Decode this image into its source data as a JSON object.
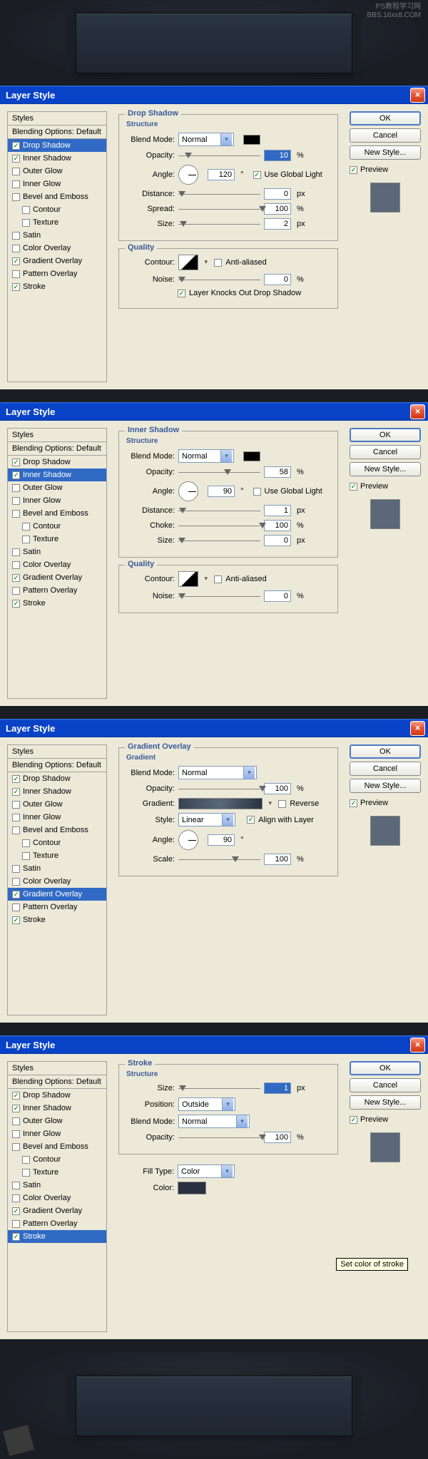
{
  "watermark": {
    "line1": "PS教程学习网",
    "line2": "BBS.16xx8.COM"
  },
  "dialogs": [
    {
      "title": "Layer Style",
      "styles_header": "Styles",
      "blending_title": "Blending Options: Default",
      "selected_style": "Drop Shadow",
      "style_items": [
        {
          "label": "Drop Shadow",
          "checked": true,
          "selected": true
        },
        {
          "label": "Inner Shadow",
          "checked": true
        },
        {
          "label": "Outer Glow",
          "checked": false
        },
        {
          "label": "Inner Glow",
          "checked": false
        },
        {
          "label": "Bevel and Emboss",
          "checked": false
        },
        {
          "label": "Contour",
          "checked": false,
          "indent": true
        },
        {
          "label": "Texture",
          "checked": false,
          "indent": true
        },
        {
          "label": "Satin",
          "checked": false
        },
        {
          "label": "Color Overlay",
          "checked": false
        },
        {
          "label": "Gradient Overlay",
          "checked": true
        },
        {
          "label": "Pattern Overlay",
          "checked": false
        },
        {
          "label": "Stroke",
          "checked": true
        }
      ],
      "panel": {
        "section_title": "Drop Shadow",
        "structure_label": "Structure",
        "blend_mode_label": "Blend Mode:",
        "blend_mode_value": "Normal",
        "opacity_label": "Opacity:",
        "opacity_value": "10",
        "opacity_unit": "%",
        "angle_label": "Angle:",
        "angle_value": "120",
        "angle_unit": "°",
        "global_light_label": "Use Global Light",
        "global_light": true,
        "distance_label": "Distance:",
        "distance_value": "0",
        "distance_unit": "px",
        "spread_label": "Spread:",
        "spread_value": "100",
        "spread_unit": "%",
        "size_label": "Size:",
        "size_value": "2",
        "size_unit": "px",
        "quality_label": "Quality",
        "contour_label": "Contour:",
        "anti_aliased_label": "Anti-aliased",
        "anti_aliased": false,
        "noise_label": "Noise:",
        "noise_value": "0",
        "noise_unit": "%",
        "knockout_label": "Layer Knocks Out Drop Shadow",
        "knockout": true
      },
      "buttons": {
        "ok": "OK",
        "cancel": "Cancel",
        "new_style": "New Style...",
        "preview": "Preview"
      }
    },
    {
      "title": "Layer Style",
      "styles_header": "Styles",
      "blending_title": "Blending Options: Default",
      "selected_style": "Inner Shadow",
      "style_items": [
        {
          "label": "Drop Shadow",
          "checked": true
        },
        {
          "label": "Inner Shadow",
          "checked": true,
          "selected": true
        },
        {
          "label": "Outer Glow",
          "checked": false
        },
        {
          "label": "Inner Glow",
          "checked": false
        },
        {
          "label": "Bevel and Emboss",
          "checked": false
        },
        {
          "label": "Contour",
          "checked": false,
          "indent": true
        },
        {
          "label": "Texture",
          "checked": false,
          "indent": true
        },
        {
          "label": "Satin",
          "checked": false
        },
        {
          "label": "Color Overlay",
          "checked": false
        },
        {
          "label": "Gradient Overlay",
          "checked": true
        },
        {
          "label": "Pattern Overlay",
          "checked": false
        },
        {
          "label": "Stroke",
          "checked": true
        }
      ],
      "panel": {
        "section_title": "Inner Shadow",
        "structure_label": "Structure",
        "blend_mode_label": "Blend Mode:",
        "blend_mode_value": "Normal",
        "opacity_label": "Opacity:",
        "opacity_value": "58",
        "opacity_unit": "%",
        "angle_label": "Angle:",
        "angle_value": "90",
        "angle_unit": "°",
        "global_light_label": "Use Global Light",
        "global_light": false,
        "distance_label": "Distance:",
        "distance_value": "1",
        "distance_unit": "px",
        "choke_label": "Choke:",
        "choke_value": "100",
        "choke_unit": "%",
        "size_label": "Size:",
        "size_value": "0",
        "size_unit": "px",
        "quality_label": "Quality",
        "contour_label": "Contour:",
        "anti_aliased_label": "Anti-aliased",
        "anti_aliased": false,
        "noise_label": "Noise:",
        "noise_value": "0",
        "noise_unit": "%"
      },
      "buttons": {
        "ok": "OK",
        "cancel": "Cancel",
        "new_style": "New Style...",
        "preview": "Preview"
      }
    },
    {
      "title": "Layer Style",
      "styles_header": "Styles",
      "blending_title": "Blending Options: Default",
      "selected_style": "Gradient Overlay",
      "style_items": [
        {
          "label": "Drop Shadow",
          "checked": true
        },
        {
          "label": "Inner Shadow",
          "checked": true
        },
        {
          "label": "Outer Glow",
          "checked": false
        },
        {
          "label": "Inner Glow",
          "checked": false
        },
        {
          "label": "Bevel and Emboss",
          "checked": false
        },
        {
          "label": "Contour",
          "checked": false,
          "indent": true
        },
        {
          "label": "Texture",
          "checked": false,
          "indent": true
        },
        {
          "label": "Satin",
          "checked": false
        },
        {
          "label": "Color Overlay",
          "checked": false
        },
        {
          "label": "Gradient Overlay",
          "checked": true,
          "selected": true
        },
        {
          "label": "Pattern Overlay",
          "checked": false
        },
        {
          "label": "Stroke",
          "checked": true
        }
      ],
      "panel": {
        "section_title": "Gradient Overlay",
        "gradient_label": "Gradient",
        "blend_mode_label": "Blend Mode:",
        "blend_mode_value": "Normal",
        "opacity_label": "Opacity:",
        "opacity_value": "100",
        "opacity_unit": "%",
        "gradient_field_label": "Gradient:",
        "reverse_label": "Reverse",
        "reverse": false,
        "style_label": "Style:",
        "style_value": "Linear",
        "align_label": "Align with Layer",
        "align": true,
        "angle_label": "Angle:",
        "angle_value": "90",
        "angle_unit": "°",
        "scale_label": "Scale:",
        "scale_value": "100",
        "scale_unit": "%"
      },
      "buttons": {
        "ok": "OK",
        "cancel": "Cancel",
        "new_style": "New Style...",
        "preview": "Preview"
      }
    },
    {
      "title": "Layer Style",
      "styles_header": "Styles",
      "blending_title": "Blending Options: Default",
      "selected_style": "Stroke",
      "style_items": [
        {
          "label": "Drop Shadow",
          "checked": true
        },
        {
          "label": "Inner Shadow",
          "checked": true
        },
        {
          "label": "Outer Glow",
          "checked": false
        },
        {
          "label": "Inner Glow",
          "checked": false
        },
        {
          "label": "Bevel and Emboss",
          "checked": false
        },
        {
          "label": "Contour",
          "checked": false,
          "indent": true
        },
        {
          "label": "Texture",
          "checked": false,
          "indent": true
        },
        {
          "label": "Satin",
          "checked": false
        },
        {
          "label": "Color Overlay",
          "checked": false
        },
        {
          "label": "Gradient Overlay",
          "checked": true
        },
        {
          "label": "Pattern Overlay",
          "checked": false
        },
        {
          "label": "Stroke",
          "checked": true,
          "selected": true
        }
      ],
      "panel": {
        "section_title": "Stroke",
        "structure_label": "Structure",
        "size_label": "Size:",
        "size_value": "1",
        "size_unit": "px",
        "position_label": "Position:",
        "position_value": "Outside",
        "blend_mode_label": "Blend Mode:",
        "blend_mode_value": "Normal",
        "opacity_label": "Opacity:",
        "opacity_value": "100",
        "opacity_unit": "%",
        "fill_type_label": "Fill Type:",
        "fill_type_value": "Color",
        "color_label": "Color:",
        "tooltip": "Set color of stroke"
      },
      "buttons": {
        "ok": "OK",
        "cancel": "Cancel",
        "new_style": "New Style...",
        "preview": "Preview"
      }
    }
  ]
}
